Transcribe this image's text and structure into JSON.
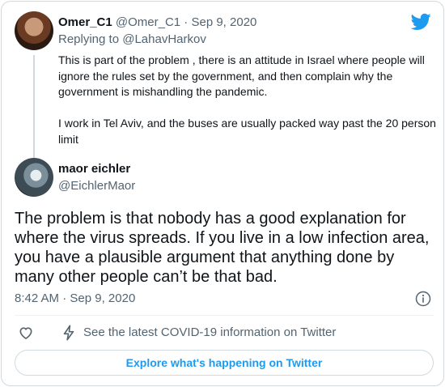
{
  "parent_tweet": {
    "display_name": "Omer_C1",
    "handle": "@Omer_C1",
    "separator": "·",
    "date": "Sep 9, 2020",
    "replying_to_prefix": "Replying to",
    "replying_to_handle": "@LahavHarkov",
    "paragraphs": [
      "This is part of the problem , there is an attitude in Israel where people will ignore the rules set by the government, and then complain why the government is mishandling the pandemic.",
      "I work in Tel Aviv, and the buses are usually packed way past the 20 person limit"
    ]
  },
  "main_tweet": {
    "display_name": "maor eichler",
    "handle": "@EichlerMaor",
    "text": "The problem is that nobody has a good explanation for where the virus spreads. If you live in a low infection area, you have a plausible argument that anything done by many other people can’t be that bad.",
    "time": "8:42 AM",
    "separator": "·",
    "date": "Sep 9, 2020"
  },
  "actions": {
    "covid_link": "See the latest COVID-19 information on Twitter"
  },
  "explore_button": "Explore what's happening on Twitter",
  "colors": {
    "accent": "#1d9bf0",
    "text": "#0f1419",
    "muted": "#536471",
    "border": "#cfd9de"
  },
  "icons": [
    "twitter-bird-icon",
    "heart-icon",
    "lightning-bolt-icon",
    "info-icon"
  ]
}
